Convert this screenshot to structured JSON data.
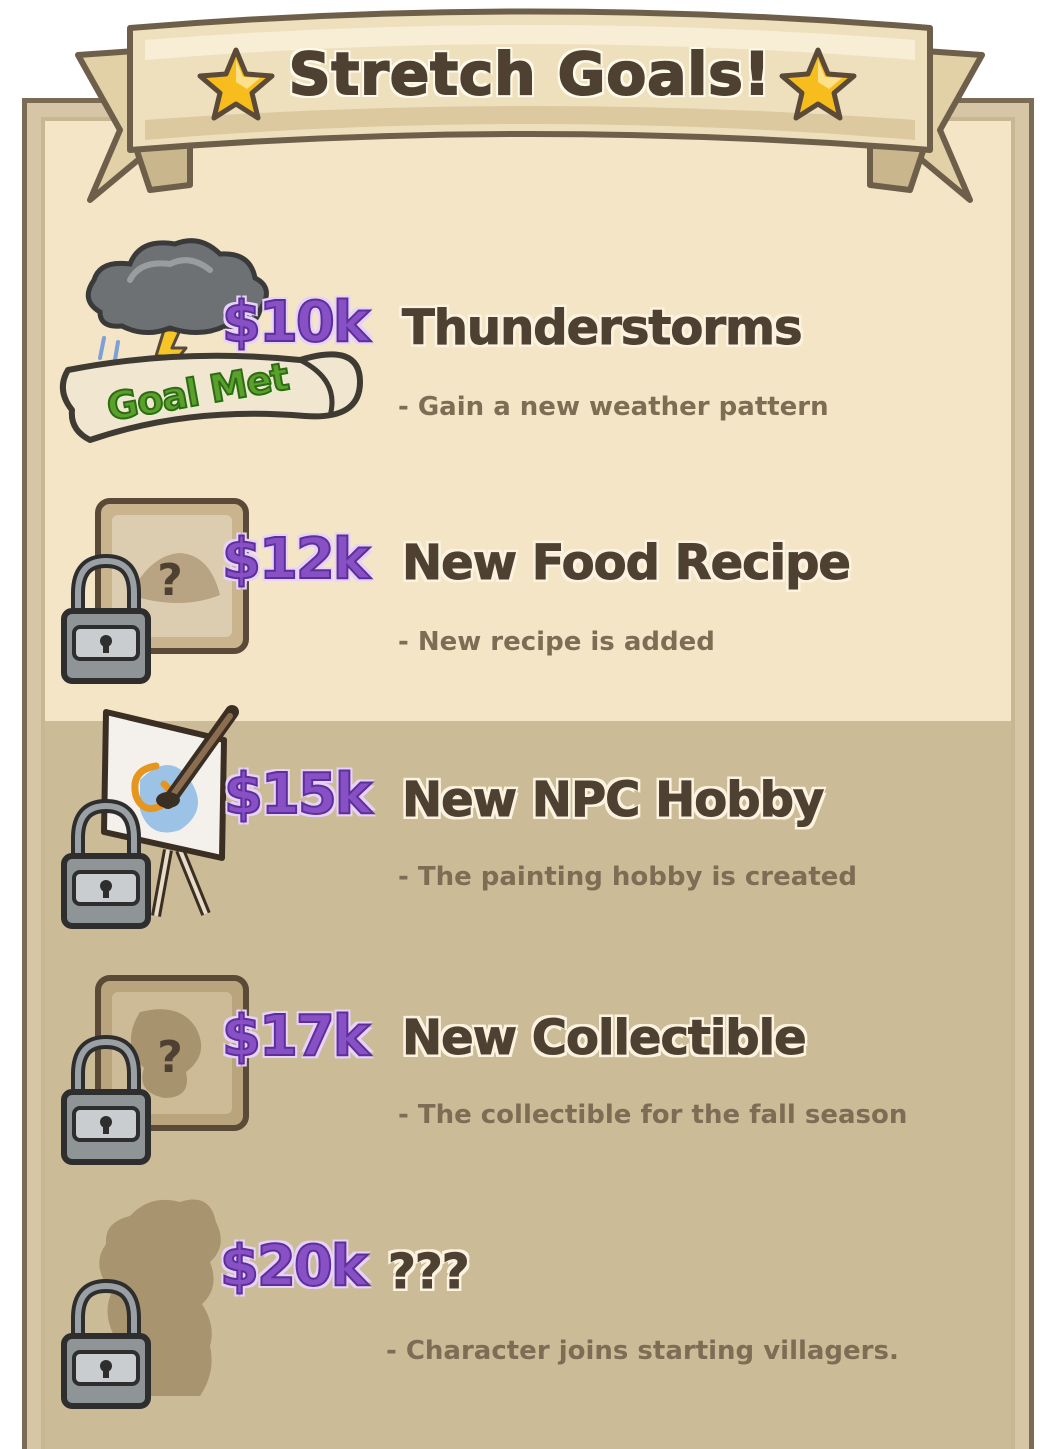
{
  "header": {
    "title": "Stretch Goals!",
    "icon": "star-icon"
  },
  "colors": {
    "panel_light": "#f3e5c6",
    "panel_dark": "#ccbb97",
    "price_purple": "#8750c5",
    "title_brown": "#4f4132",
    "goal_met_green": "#5aa02c"
  },
  "goals": [
    {
      "price": "$10k",
      "title": "Thunderstorms",
      "desc": "- Gain a new weather pattern",
      "status": "Goal Met",
      "icon": "storm-cloud-icon"
    },
    {
      "price": "$12k",
      "title": "New Food Recipe",
      "desc": "- New recipe is added",
      "status": "locked",
      "icon": "mystery-food-icon"
    },
    {
      "price": "$15k",
      "title": "New NPC Hobby",
      "desc": "- The painting hobby is created",
      "status": "locked",
      "icon": "easel-painting-icon"
    },
    {
      "price": "$17k",
      "title": "New Collectible",
      "desc": "- The collectible for the fall season",
      "status": "locked",
      "icon": "mystery-collectible-icon"
    },
    {
      "price": "$20k",
      "title": "???",
      "desc": "- Character joins starting villagers.",
      "status": "locked",
      "icon": "character-silhouette-icon"
    }
  ]
}
